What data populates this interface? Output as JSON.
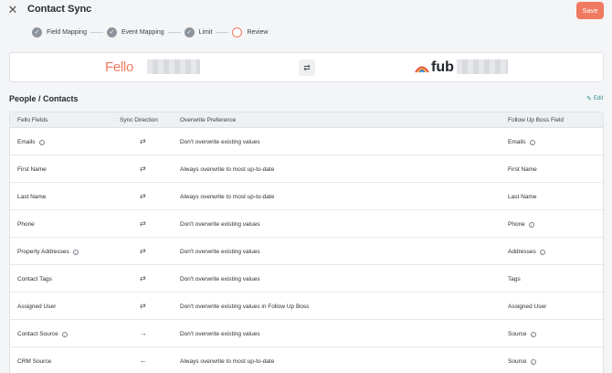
{
  "header": {
    "title": "Contact Sync",
    "save_label": "Save"
  },
  "steps": [
    {
      "label": "Field Mapping",
      "state": "done"
    },
    {
      "label": "Event Mapping",
      "state": "done"
    },
    {
      "label": "Limit",
      "state": "done"
    },
    {
      "label": "Review",
      "state": "active"
    }
  ],
  "logos": {
    "left": "Fello",
    "right": "fub",
    "swap_icon": "swap-arrows-icon"
  },
  "section": {
    "title": "People / Contacts",
    "edit_label": "Edit"
  },
  "table": {
    "columns": [
      "Fello Fields",
      "Sync Direction",
      "Overwrite Preference",
      "Follow Up Boss Field"
    ],
    "rows": [
      {
        "fello": "Emails",
        "fello_info": true,
        "dir": "⇄",
        "pref": "Don't overwrite existing values",
        "fub": "Emails",
        "fub_info": true
      },
      {
        "fello": "First Name",
        "fello_info": false,
        "dir": "⇄",
        "pref": "Always overwrite to most up-to-date",
        "fub": "First Name",
        "fub_info": false
      },
      {
        "fello": "Last Name",
        "fello_info": false,
        "dir": "⇄",
        "pref": "Always overwrite to most up-to-date",
        "fub": "Last Name",
        "fub_info": false
      },
      {
        "fello": "Phone",
        "fello_info": false,
        "dir": "⇄",
        "pref": "Don't overwrite existing values",
        "fub": "Phone",
        "fub_info": true
      },
      {
        "fello": "Property Addresses",
        "fello_info": true,
        "dir": "⇄",
        "pref": "Don't overwrite existing values",
        "fub": "Addresses",
        "fub_info": true
      },
      {
        "fello": "Contact Tags",
        "fello_info": false,
        "dir": "⇄",
        "pref": "Don't overwrite existing values",
        "fub": "Tags",
        "fub_info": false
      },
      {
        "fello": "Assigned User",
        "fello_info": false,
        "dir": "⇄",
        "pref": "Don't overwrite existing values in Follow Up Boss",
        "fub": "Assigned User",
        "fub_info": false
      },
      {
        "fello": "Contact Source",
        "fello_info": true,
        "dir": "→",
        "pref": "Don't overwrite existing values",
        "fub": "Source",
        "fub_info": true
      },
      {
        "fello": "CRM Source",
        "fello_info": false,
        "dir": "←",
        "pref": "Always overwrite to most up-to-date",
        "fub": "Source",
        "fub_info": true
      }
    ]
  },
  "colors": {
    "accent": "#f07a5f",
    "link": "#2d8c8c",
    "step_done": "#8d949c"
  }
}
